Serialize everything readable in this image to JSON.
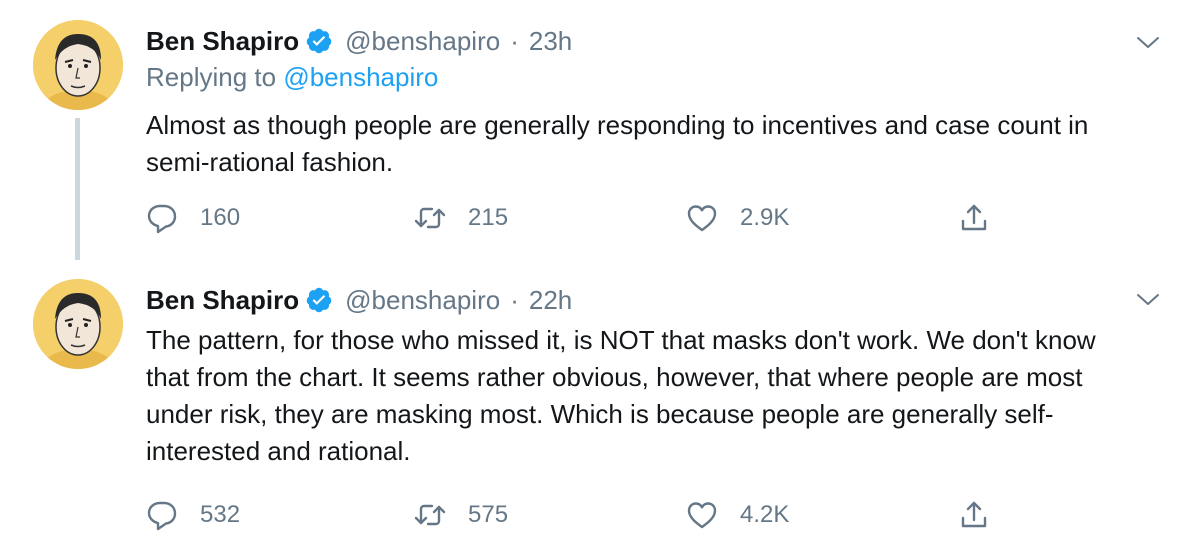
{
  "colors": {
    "text": "#14171a",
    "secondary": "#657786",
    "link": "#1da1f2",
    "verified": "#1da1f2",
    "thread_line": "#ccd6dd"
  },
  "tweets": [
    {
      "author": "Ben Shapiro",
      "handle": "@benshapiro",
      "separator": "·",
      "time": "23h",
      "replying_prefix": "Replying to ",
      "replying_to": "@benshapiro",
      "text": "Almost as though people are generally responding to incentives and case count in semi-rational fashion.",
      "replies": "160",
      "retweets": "215",
      "likes": "2.9K",
      "icons": [
        "reply-icon",
        "retweet-icon",
        "like-icon",
        "share-icon"
      ]
    },
    {
      "author": "Ben Shapiro",
      "handle": "@benshapiro",
      "separator": "·",
      "time": "22h",
      "text": "The pattern, for those who missed it, is NOT that masks don't work. We don't know that from the chart. It seems rather obvious, however, that where people are most under risk, they are masking most. Which is because people are generally self-interested and rational.",
      "replies": "532",
      "retweets": "575",
      "likes": "4.2K",
      "icons": [
        "reply-icon",
        "retweet-icon",
        "like-icon",
        "share-icon"
      ]
    }
  ]
}
